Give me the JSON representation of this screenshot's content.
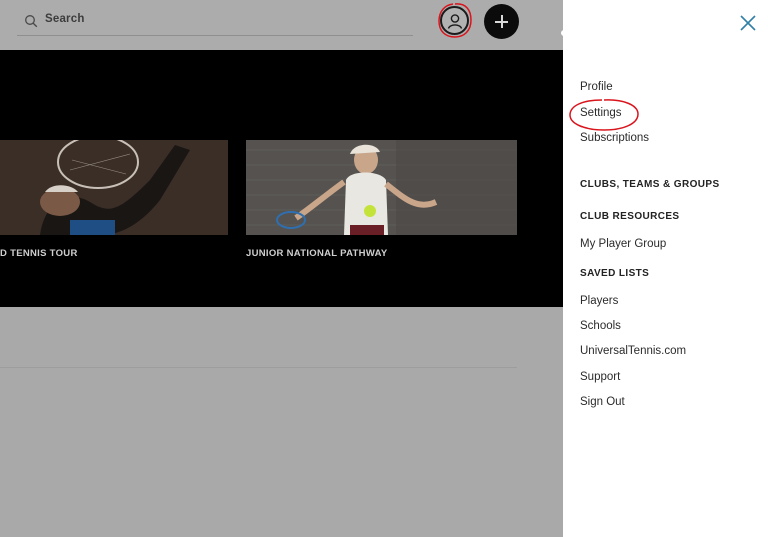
{
  "header": {
    "search_label": "Search"
  },
  "hero": {
    "cards": [
      {
        "title": "D TENNIS TOUR"
      },
      {
        "title": "JUNIOR NATIONAL PATHWAY"
      }
    ]
  },
  "panel": {
    "menu": [
      {
        "label": "Profile",
        "kind": "item"
      },
      {
        "label": "Settings",
        "kind": "item"
      },
      {
        "label": "Subscriptions",
        "kind": "item"
      },
      {
        "label": "CLUBS, TEAMS & GROUPS",
        "kind": "heading"
      },
      {
        "label": "CLUB RESOURCES",
        "kind": "heading"
      },
      {
        "label": "My Player Group",
        "kind": "item"
      },
      {
        "label": "SAVED LISTS",
        "kind": "heading"
      },
      {
        "label": "Players",
        "kind": "item"
      },
      {
        "label": "Schools",
        "kind": "item"
      },
      {
        "label": "UniversalTennis.com",
        "kind": "item"
      },
      {
        "label": "Support",
        "kind": "item"
      },
      {
        "label": "Sign Out",
        "kind": "item"
      }
    ]
  },
  "colors": {
    "overlay": "#a9a9aa",
    "panel_bg": "#ffffff",
    "annotation_red": "#d9141c",
    "close_icon": "#2f7fa6"
  }
}
